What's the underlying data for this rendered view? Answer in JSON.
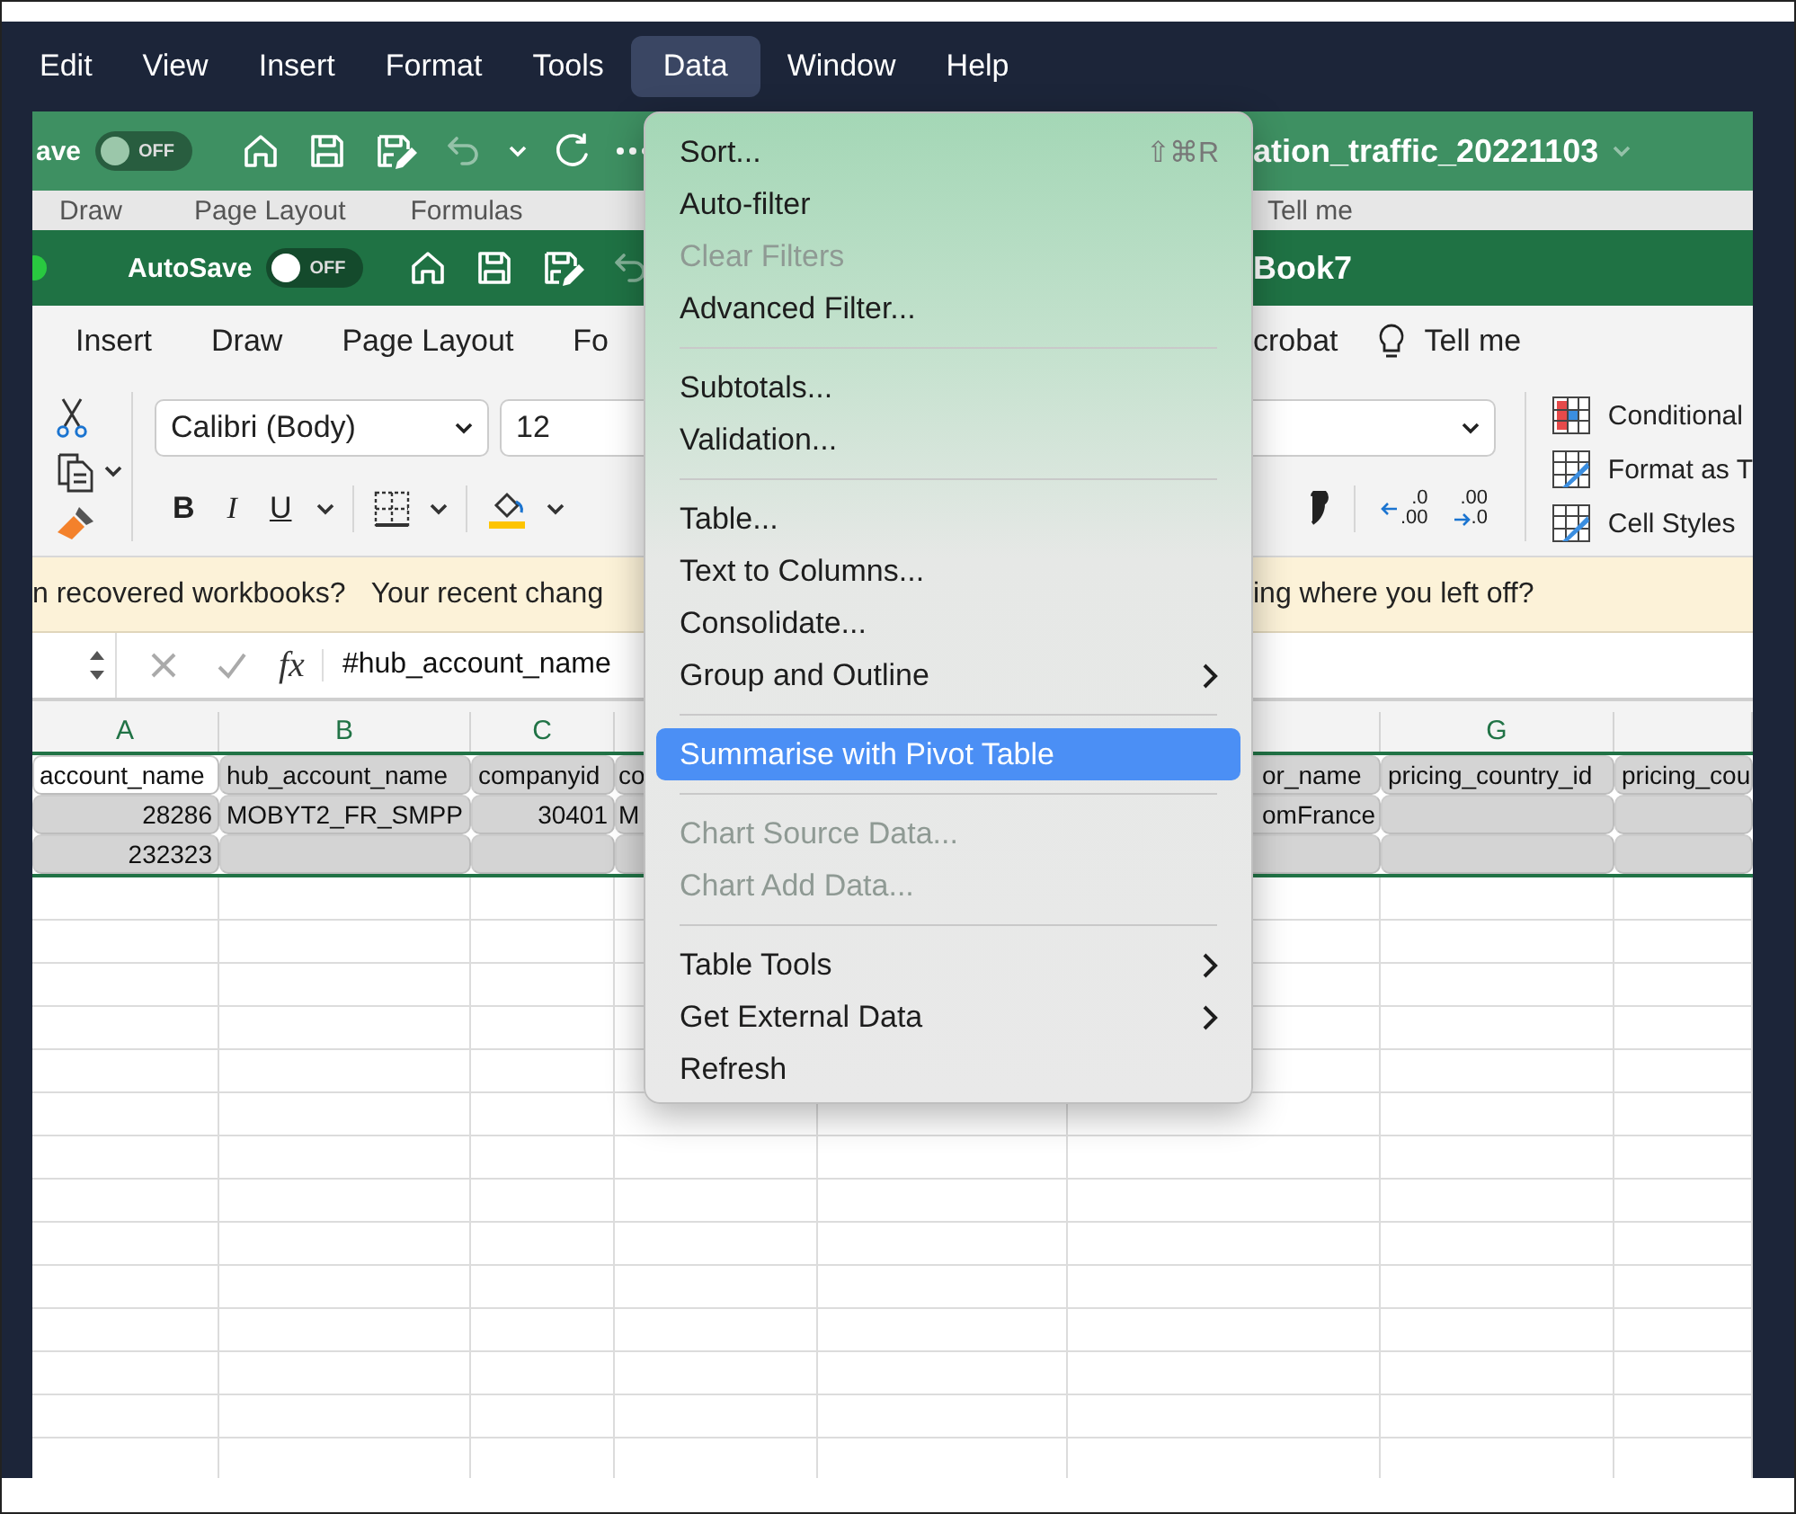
{
  "menu_bar": {
    "items": [
      {
        "label": "Edit",
        "selected": false
      },
      {
        "label": "View",
        "selected": false
      },
      {
        "label": "Insert",
        "selected": false
      },
      {
        "label": "Format",
        "selected": false
      },
      {
        "label": "Tools",
        "selected": false
      },
      {
        "label": "Data",
        "selected": true
      },
      {
        "label": "Window",
        "selected": false
      },
      {
        "label": "Help",
        "selected": false
      }
    ]
  },
  "back_window": {
    "autosave_label": "ave",
    "autosave_on": false,
    "toggle_text": "OFF",
    "title": "ation_traffic_20221103",
    "ribbon_tabs": [
      "Draw",
      "Page Layout",
      "Formulas",
      "Tell me"
    ]
  },
  "window": {
    "autosave_label": "AutoSave",
    "autosave_on": false,
    "toggle_text": "OFF",
    "title": "Book7",
    "ribbon_tabs_left": [
      "Insert",
      "Draw",
      "Page Layout",
      "Fo"
    ],
    "ribbon_tabs_right": [
      "crobat",
      "Tell me"
    ]
  },
  "ribbon": {
    "font": "Calibri (Body)",
    "font_size": "12",
    "format_buttons": [
      "B",
      "I",
      "U"
    ],
    "decimal_buttons": [
      {
        "top": ".0",
        "bottom": ".00"
      },
      {
        "top": ".00",
        "bottom": ".0"
      }
    ],
    "styles": [
      "Conditional",
      "Format as T",
      "Cell Styles"
    ]
  },
  "notification": {
    "left_texts": [
      "n recovered workbooks?",
      "Your recent chang"
    ],
    "right_text": "ing where you left off?"
  },
  "formula_bar": {
    "function_label": "fx",
    "value": "#hub_account_name"
  },
  "sheet": {
    "columns": [
      {
        "header": "A"
      },
      {
        "header": "B"
      },
      {
        "header": "C"
      },
      {},
      {},
      {},
      {
        "header": "G"
      },
      {}
    ],
    "rows": [
      {
        "selected": true,
        "cells": [
          {
            "text": "account_name",
            "active": true
          },
          {
            "text": "hub_account_name"
          },
          {
            "text": "companyid"
          },
          {
            "text": "co"
          },
          {},
          {
            "text": "or_name"
          },
          {
            "text": "pricing_country_id"
          },
          {
            "text": "pricing_cou"
          }
        ]
      },
      {
        "selected": true,
        "cells": [
          {
            "text": "28286",
            "kind": "number"
          },
          {
            "text": "MOBYT2_FR_SMPP"
          },
          {
            "text": "30401",
            "kind": "number"
          },
          {
            "text": "M"
          },
          {},
          {
            "text": "omFrance"
          },
          {},
          {}
        ]
      },
      {
        "selected": true,
        "cells": [
          {
            "text": "232323",
            "kind": "number"
          },
          {},
          {},
          {},
          {},
          {},
          {},
          {}
        ]
      }
    ]
  },
  "menu": {
    "items": [
      {
        "kind": "item",
        "label": "Sort...",
        "shortcut": "⇧⌘R",
        "disabled": false,
        "selected": false,
        "submenu": false
      },
      {
        "kind": "item",
        "label": "Auto-filter",
        "disabled": false,
        "selected": false,
        "submenu": false
      },
      {
        "kind": "item",
        "label": "Clear Filters",
        "disabled": true,
        "selected": false,
        "submenu": false
      },
      {
        "kind": "item",
        "label": "Advanced Filter...",
        "disabled": false,
        "selected": false,
        "submenu": false
      },
      {
        "kind": "separator"
      },
      {
        "kind": "item",
        "label": "Subtotals...",
        "disabled": false,
        "selected": false,
        "submenu": false
      },
      {
        "kind": "item",
        "label": "Validation...",
        "disabled": false,
        "selected": false,
        "submenu": false
      },
      {
        "kind": "separator"
      },
      {
        "kind": "item",
        "label": "Table...",
        "disabled": false,
        "selected": false,
        "submenu": false
      },
      {
        "kind": "item",
        "label": "Text to Columns...",
        "disabled": false,
        "selected": false,
        "submenu": false
      },
      {
        "kind": "item",
        "label": "Consolidate...",
        "disabled": false,
        "selected": false,
        "submenu": false
      },
      {
        "kind": "item",
        "label": "Group and Outline",
        "disabled": false,
        "selected": false,
        "submenu": true
      },
      {
        "kind": "separator"
      },
      {
        "kind": "item",
        "label": "Summarise with Pivot Table",
        "disabled": false,
        "selected": true,
        "submenu": false
      },
      {
        "kind": "separator"
      },
      {
        "kind": "item",
        "label": "Chart Source Data...",
        "disabled": true,
        "selected": false,
        "submenu": false
      },
      {
        "kind": "item",
        "label": "Chart Add Data...",
        "disabled": true,
        "selected": false,
        "submenu": false
      },
      {
        "kind": "separator"
      },
      {
        "kind": "item",
        "label": "Table Tools",
        "disabled": false,
        "selected": false,
        "submenu": true
      },
      {
        "kind": "item",
        "label": "Get External Data",
        "disabled": false,
        "selected": false,
        "submenu": true
      },
      {
        "kind": "item",
        "label": "Refresh",
        "disabled": false,
        "selected": false,
        "submenu": false
      }
    ]
  }
}
